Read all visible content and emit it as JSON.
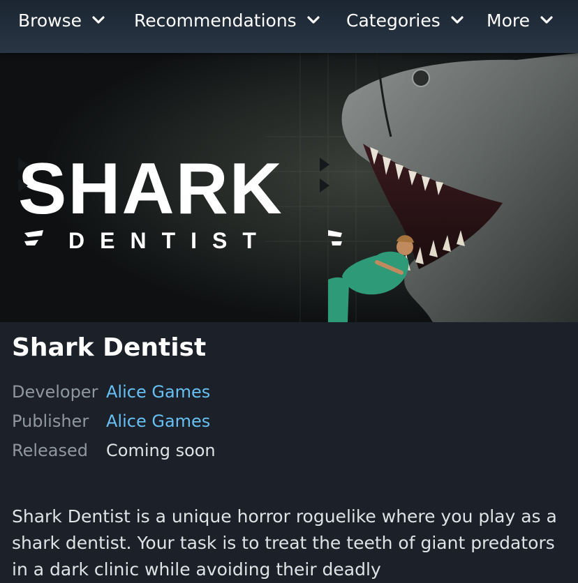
{
  "nav": {
    "items": [
      {
        "label": "Browse"
      },
      {
        "label": "Recommendations"
      },
      {
        "label": "Categories"
      },
      {
        "label": "More"
      }
    ],
    "chevron_icon": "chevron-down-icon"
  },
  "hero": {
    "logo_main": "SHARK",
    "logo_sub": "DENTIST"
  },
  "game": {
    "title": "Shark Dentist",
    "developer_label": "Developer",
    "developer": "Alice Games",
    "publisher_label": "Publisher",
    "publisher": "Alice Games",
    "released_label": "Released",
    "released": "Coming soon",
    "description": "Shark Dentist is a unique horror roguelike where you play as a shark dentist. Your task is to treat the teeth of giant predators in a dark clinic while avoiding their deadly"
  },
  "colors": {
    "background": "#1b2029",
    "link": "#66c0f4",
    "label": "#8f98a0",
    "text": "#dfe3e6"
  }
}
